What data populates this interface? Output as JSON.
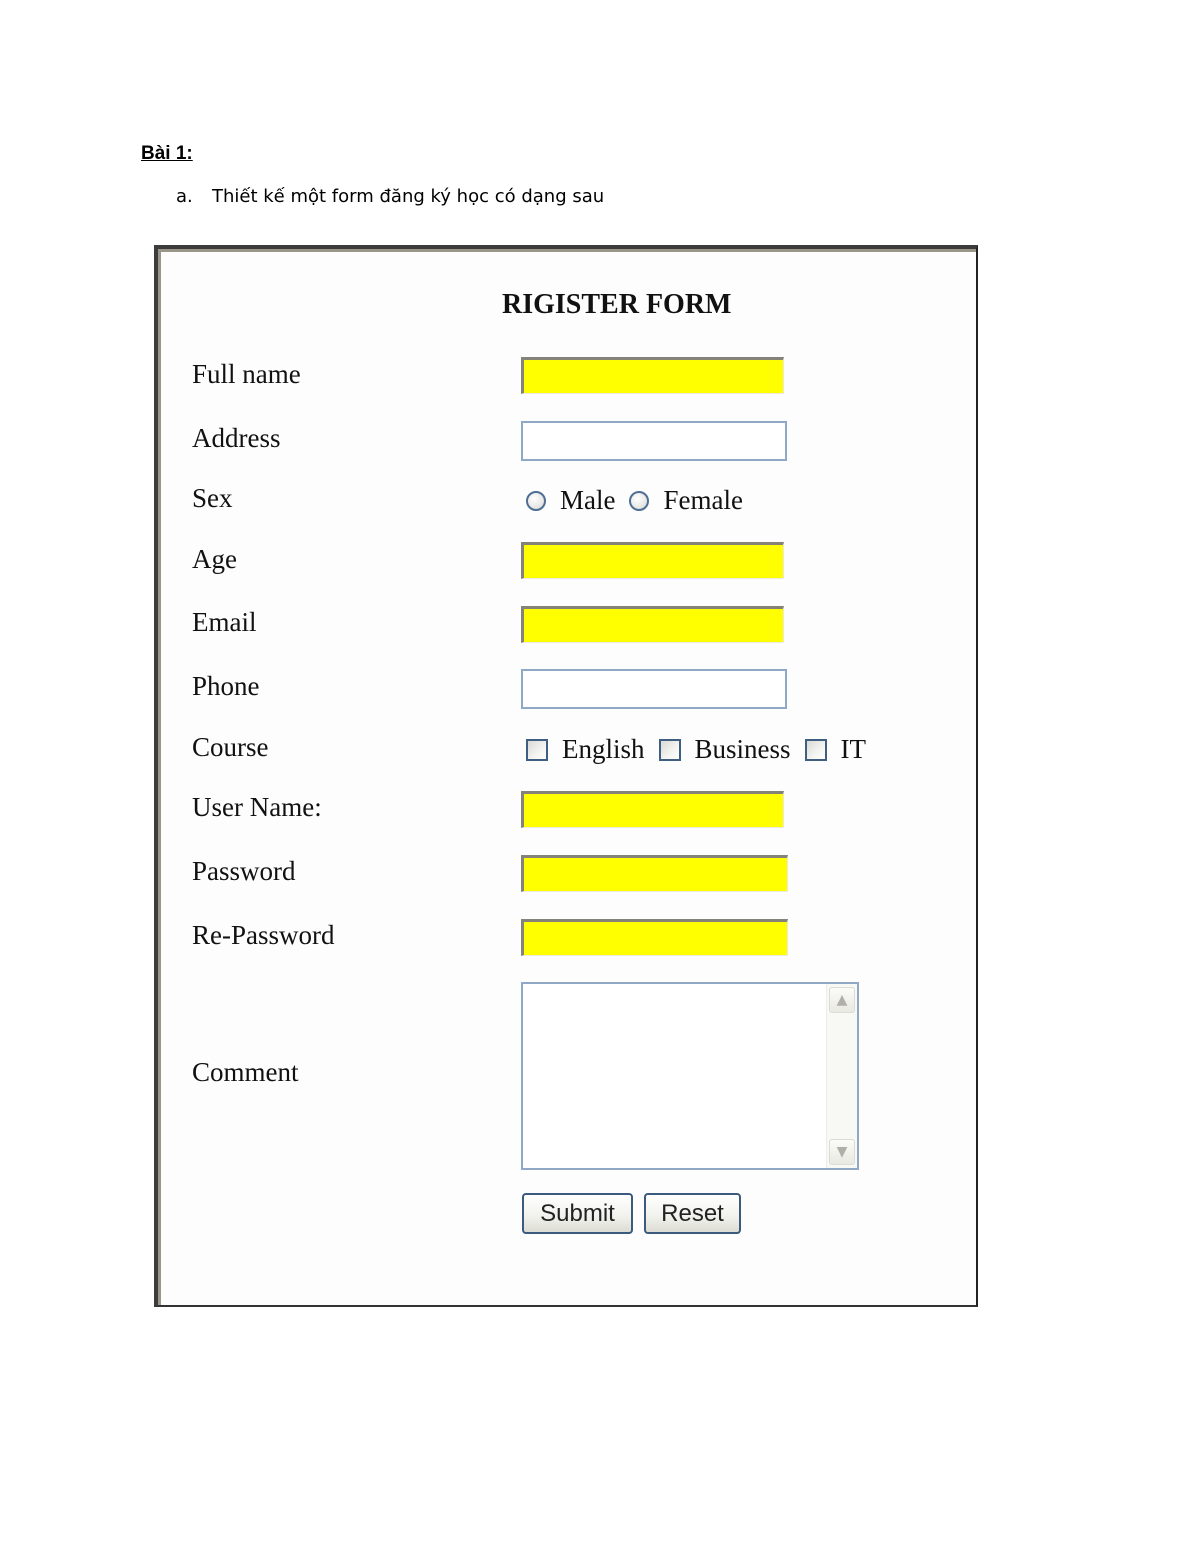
{
  "document": {
    "heading": "Bài 1:",
    "item_marker": "a.",
    "item_text": "Thiết kế một form đăng ký học có dạng sau"
  },
  "form": {
    "title": "RIGISTER FORM",
    "field_highlight_color": "#ffff00",
    "fields": {
      "full_name": {
        "label": "Full name",
        "value": ""
      },
      "address": {
        "label": "Address",
        "value": ""
      },
      "sex": {
        "label": "Sex",
        "options": [
          "Male",
          "Female"
        ],
        "selected": null
      },
      "age": {
        "label": "Age",
        "value": ""
      },
      "email": {
        "label": "Email",
        "value": ""
      },
      "phone": {
        "label": "Phone",
        "value": ""
      },
      "course": {
        "label": "Course",
        "options": [
          "English",
          "Business",
          "IT"
        ],
        "checked": []
      },
      "user_name": {
        "label": "User Name:",
        "value": ""
      },
      "password": {
        "label": "Password",
        "value": ""
      },
      "re_password": {
        "label": "Re-Password",
        "value": ""
      },
      "comment": {
        "label": "Comment",
        "value": ""
      }
    },
    "buttons": {
      "submit": "Submit",
      "reset": "Reset"
    },
    "icons": {
      "scroll_up": "▲",
      "scroll_down": "▼"
    }
  }
}
